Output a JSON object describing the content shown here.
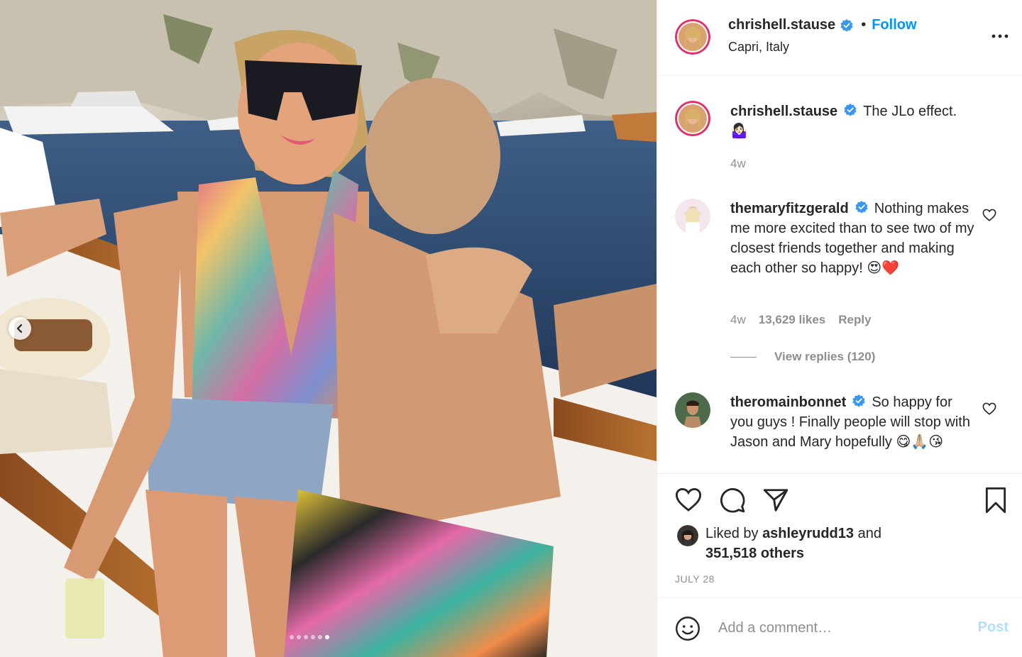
{
  "post": {
    "author": "chrishell.stause",
    "follow_label": "Follow",
    "separator": "•",
    "location": "Capri, Italy"
  },
  "caption": {
    "author": "chrishell.stause",
    "text": "The JLo effect.",
    "emoji": "🤷🏻‍♀️",
    "time": "4w"
  },
  "comments": [
    {
      "author": "themaryfitzgerald",
      "text": "Nothing makes me more excited than to see two of my closest friends together and making each other so happy! 😍❤️",
      "time": "4w",
      "likes": "13,629 likes",
      "reply_label": "Reply",
      "view_replies": "View replies (120)"
    },
    {
      "author": "theromainbonnet",
      "text": "So happy for you guys ! Finally people will stop with Jason and Mary hopefully 😋🙏🏼😘"
    }
  ],
  "liked_by": {
    "prefix": "Liked by",
    "user": "ashleyrudd13",
    "conjunction": "and",
    "others": "351,518 others"
  },
  "date": "JULY 28",
  "comment_box": {
    "placeholder": "Add a comment…",
    "post_label": "Post"
  },
  "carousel": {
    "total": 6,
    "active_index": 5
  },
  "icons": {
    "more": "more-options-icon",
    "like": "heart-icon",
    "comment": "comment-bubble-icon",
    "share": "paper-plane-icon",
    "save": "bookmark-icon",
    "emoji": "smiley-icon",
    "verified": "verified-badge-icon",
    "prev": "chevron-left-icon"
  },
  "colors": {
    "accent": "#0095f6",
    "post_disabled": "#b2dffc",
    "muted": "#8e8e8e",
    "text": "#262626",
    "border": "#efefef"
  }
}
